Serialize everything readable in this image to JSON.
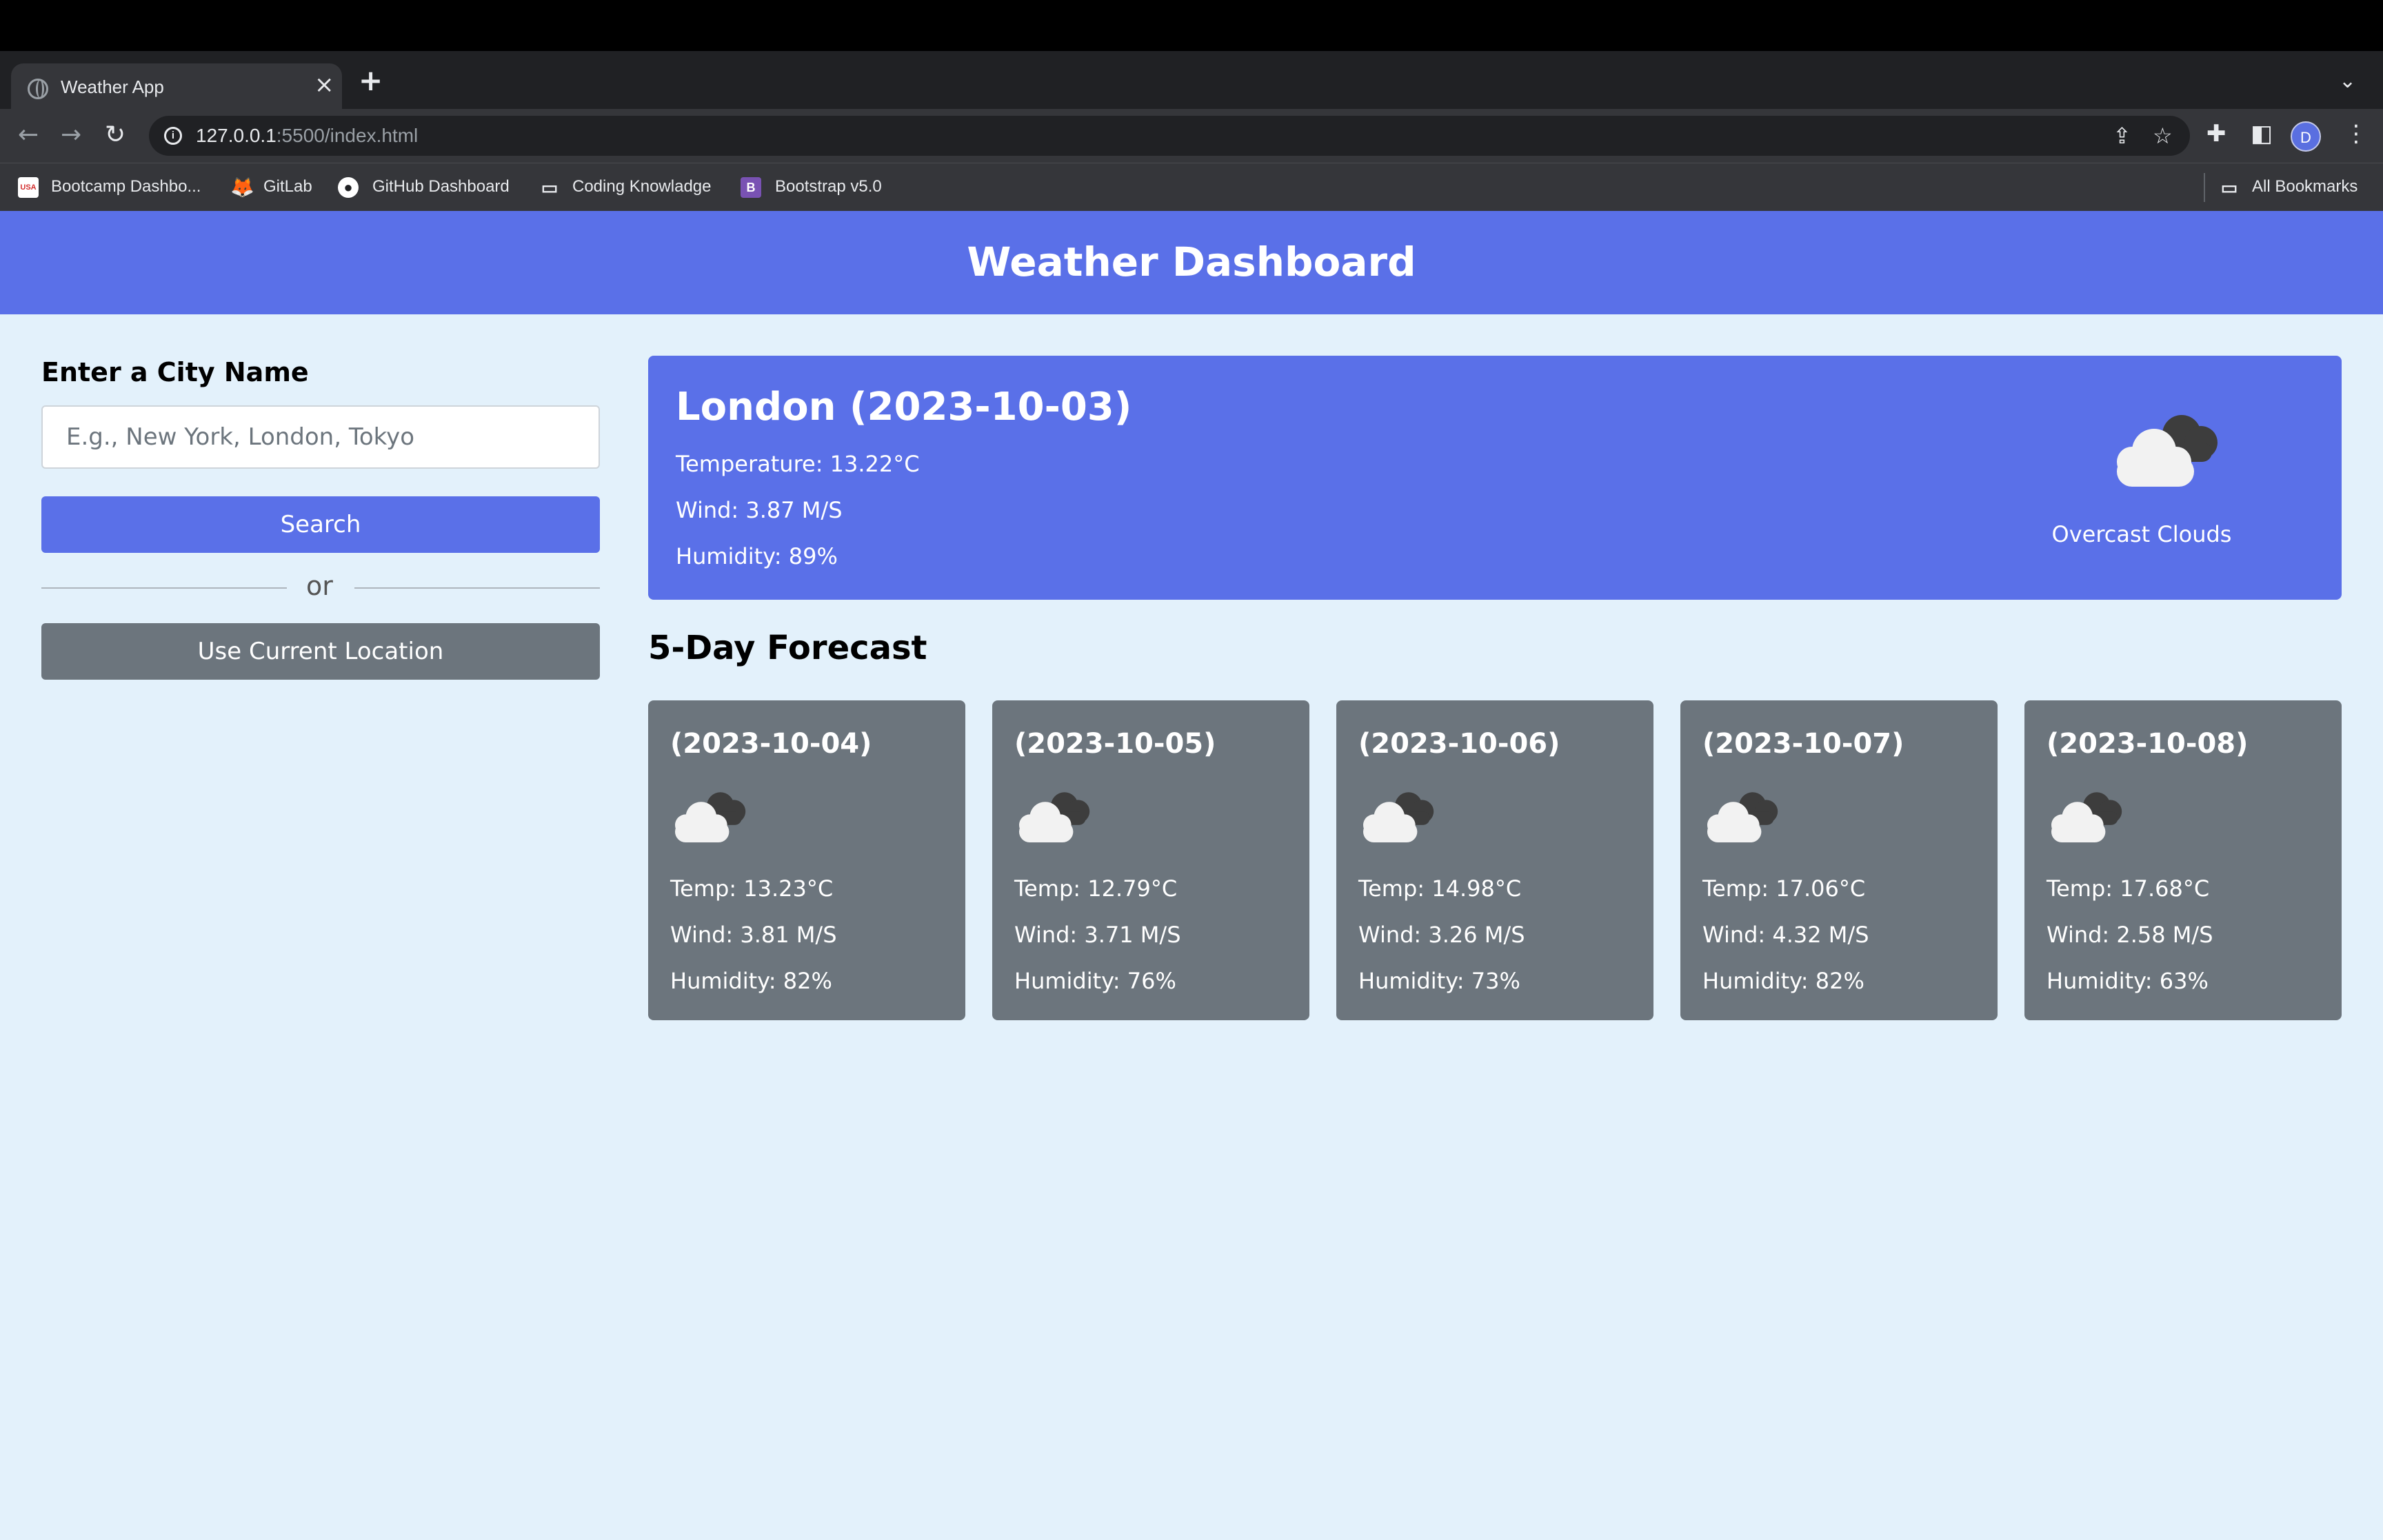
{
  "browser": {
    "tab_title": "Weather App",
    "tab_close": "×",
    "new_tab": "+",
    "tab_menu": "⌄",
    "url_host": "127.0.0.1",
    "url_rest": ":5500/index.html",
    "profile_initial": "D",
    "bookmarks": [
      {
        "label": "Bootcamp Dashbo...",
        "icon": "bootcamp-icon",
        "icon_text": "USA",
        "color": "#d32f2f"
      },
      {
        "label": "GitLab",
        "icon": "gitlab-icon",
        "icon_text": "",
        "color": "#fc6d26"
      },
      {
        "label": "GitHub Dashboard",
        "icon": "github-icon",
        "icon_text": "",
        "color": "#ffffff"
      },
      {
        "label": "Coding Knowladge",
        "icon": "folder-icon",
        "icon_text": "",
        "color": "#e8eaed"
      },
      {
        "label": "Bootstrap v5.0",
        "icon": "bootstrap-icon",
        "icon_text": "B",
        "color": "#7952b3"
      }
    ],
    "all_bookmarks": "All Bookmarks"
  },
  "header": {
    "title": "Weather Dashboard"
  },
  "sidebar": {
    "heading": "Enter a City Name",
    "input_placeholder": "E.g., New York, London, Tokyo",
    "search_label": "Search",
    "or_label": "or",
    "location_label": "Use Current Location"
  },
  "current": {
    "city_date": "London (2023-10-03)",
    "temperature": "Temperature: 13.22°C",
    "wind": "Wind: 3.87 M/S",
    "humidity": "Humidity: 89%",
    "icon": "overcast-clouds-icon",
    "description": "Overcast Clouds"
  },
  "forecast": {
    "title": "5-Day Forecast",
    "days": [
      {
        "date": "(2023-10-04)",
        "temp": "Temp: 13.23°C",
        "wind": "Wind: 3.81 M/S",
        "humidity": "Humidity: 82%",
        "icon": "clouds-icon"
      },
      {
        "date": "(2023-10-05)",
        "temp": "Temp: 12.79°C",
        "wind": "Wind: 3.71 M/S",
        "humidity": "Humidity: 76%",
        "icon": "clouds-icon"
      },
      {
        "date": "(2023-10-06)",
        "temp": "Temp: 14.98°C",
        "wind": "Wind: 3.26 M/S",
        "humidity": "Humidity: 73%",
        "icon": "clouds-icon"
      },
      {
        "date": "(2023-10-07)",
        "temp": "Temp: 17.06°C",
        "wind": "Wind: 4.32 M/S",
        "humidity": "Humidity: 82%",
        "icon": "clouds-icon"
      },
      {
        "date": "(2023-10-08)",
        "temp": "Temp: 17.68°C",
        "wind": "Wind: 2.58 M/S",
        "humidity": "Humidity: 63%",
        "icon": "clouds-icon"
      }
    ]
  },
  "colors": {
    "primary": "#5a70e8",
    "card_gray": "#6c757d",
    "page_bg": "#e3f1fb"
  }
}
